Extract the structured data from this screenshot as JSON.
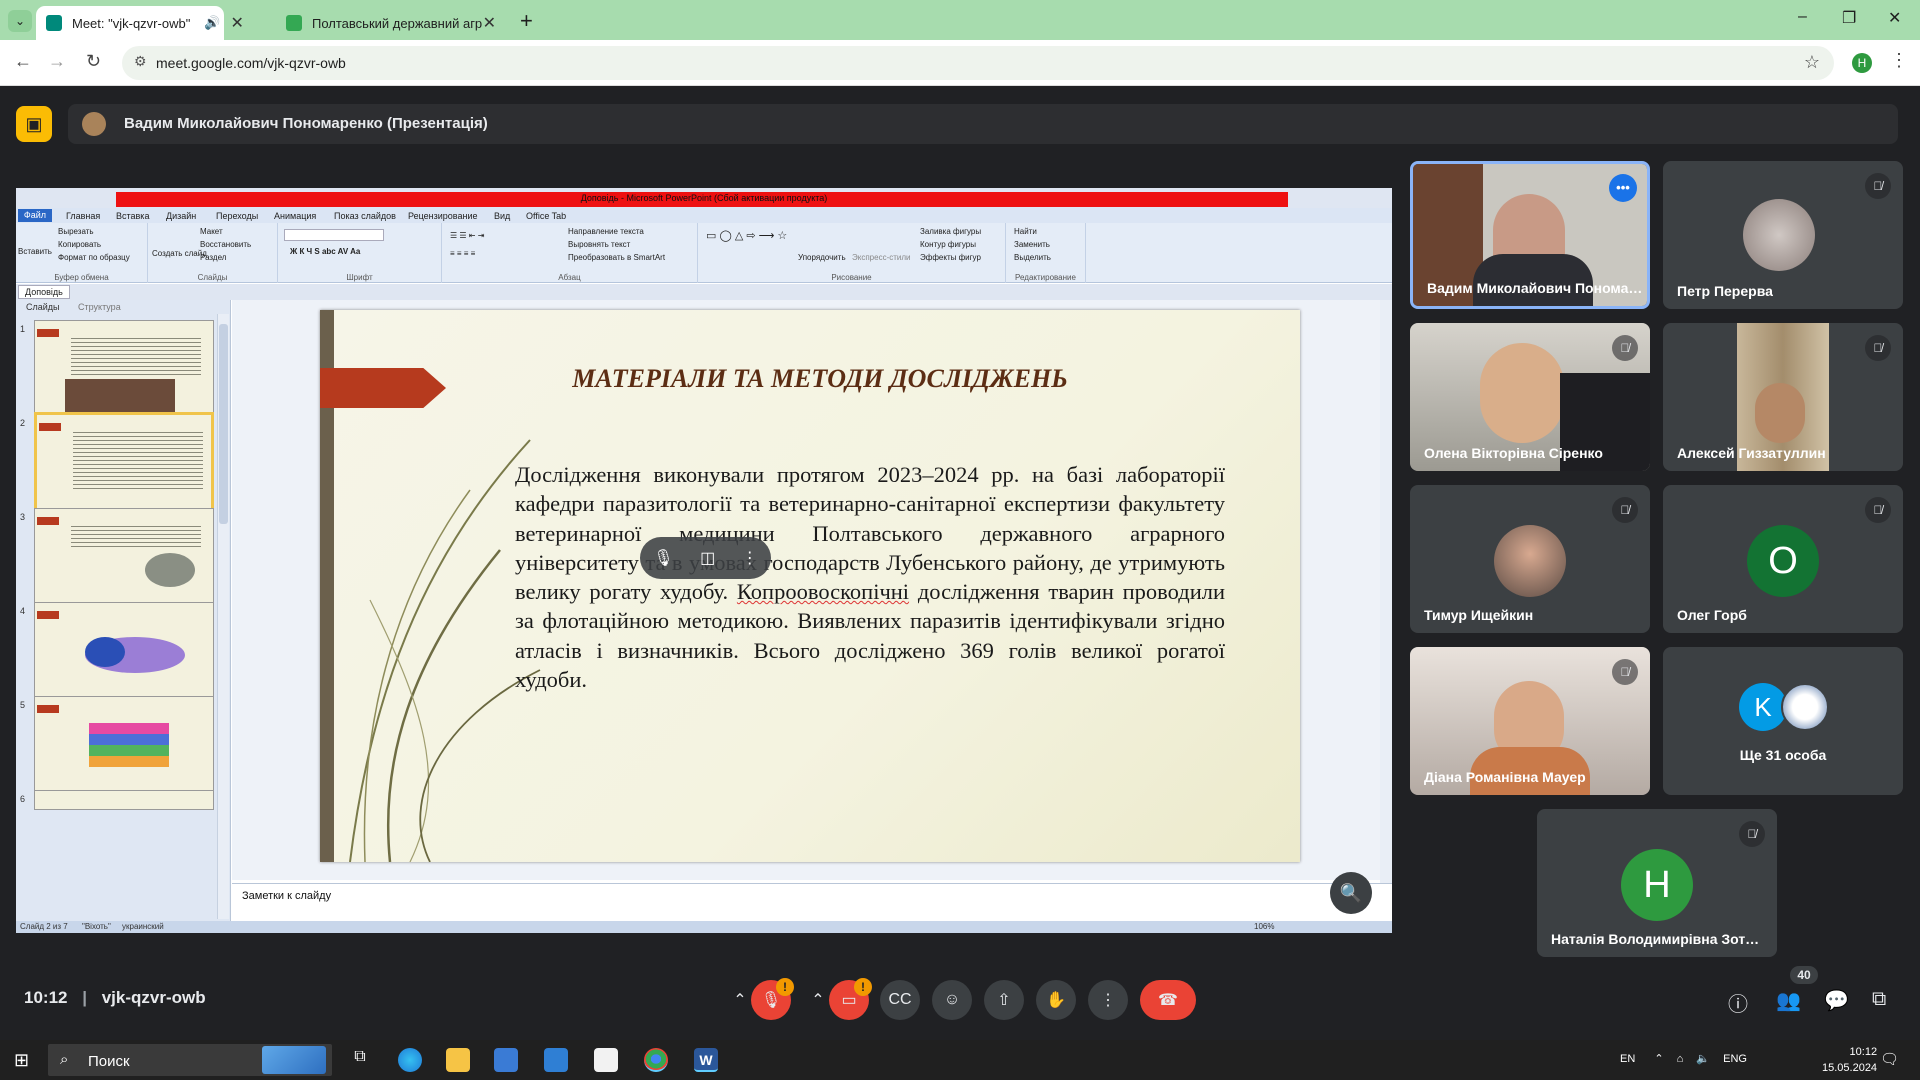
{
  "browser": {
    "tabs": [
      {
        "title": "Meet: \"vjk-qzvr-owb\"",
        "active": true
      },
      {
        "title": "Полтавський державний агра",
        "active": false
      }
    ],
    "tab_search_icon": "chevron-down-icon",
    "new_tab": "+",
    "url": "meet.google.com/vjk-qzvr-owb",
    "profile_initial": "H",
    "window_controls": {
      "minimize": "–",
      "restore": "❐",
      "close": "✕"
    }
  },
  "meet": {
    "presenter_banner": "Вадим Миколайович Пономаренко (Презентація)",
    "meeting_time": "10:12",
    "meeting_code": "vjk-qzvr-owb",
    "participants_count": "40",
    "participants": [
      {
        "name": "Вадим Миколайович Пономаренко",
        "muted": false,
        "active": true,
        "avatar_letter": ""
      },
      {
        "name": "Петр Перерва",
        "muted": true,
        "active": false,
        "avatar_letter": ""
      },
      {
        "name": "Олена Вікторівна Сіренко",
        "muted": true,
        "active": false,
        "avatar_letter": ""
      },
      {
        "name": "Алексей Гиззатуллин",
        "muted": true,
        "active": false,
        "avatar_letter": ""
      },
      {
        "name": "Тимур Ищейкин",
        "muted": true,
        "active": false,
        "avatar_letter": ""
      },
      {
        "name": "Олег Горб",
        "muted": true,
        "active": false,
        "avatar_letter": "О"
      },
      {
        "name": "Діана Романівна Мауер",
        "muted": true,
        "active": false,
        "avatar_letter": ""
      },
      {
        "name": "Ще 31 особа",
        "muted": false,
        "active": false,
        "avatar_letter": "K"
      },
      {
        "name": "Наталія Володимирівна Зотова",
        "muted": true,
        "active": false,
        "avatar_letter": "Н"
      }
    ],
    "badge_alert": "!",
    "colors": {
      "end_call": "#ea4335",
      "active_border": "#8ab4f8",
      "oleg_avatar": "#137333",
      "natalia_avatar": "#2e9a3f",
      "more_avatar": "#039be5"
    }
  },
  "powerpoint": {
    "window_title": "Доповідь - Microsoft PowerPoint (Сбой активации продукта)",
    "file_tab": "Файл",
    "ribbon_tabs": [
      "Главная",
      "Вставка",
      "Дизайн",
      "Переходы",
      "Анимация",
      "Показ слайдов",
      "Рецензирование",
      "Вид",
      "Office Tab"
    ],
    "ribbon_groups": [
      {
        "label": "Буфер обмена",
        "buttons": [
          "Вставить",
          "Вырезать",
          "Копировать",
          "Формат по образцу"
        ]
      },
      {
        "label": "Слайды",
        "buttons": [
          "Создать слайд",
          "Макет",
          "Восстановить",
          "Раздел"
        ]
      },
      {
        "label": "Шрифт",
        "buttons": []
      },
      {
        "label": "Абзац",
        "buttons": [
          "Направление текста",
          "Выровнять текст",
          "Преобразовать в SmartArt"
        ]
      },
      {
        "label": "Рисование",
        "buttons": [
          "Упорядочить",
          "Экспресс-стили",
          "Заливка фигуры",
          "Контур фигуры",
          "Эффекты фигур"
        ]
      },
      {
        "label": "Редактирование",
        "buttons": [
          "Найти",
          "Заменить",
          "Выделить"
        ]
      }
    ],
    "doc_tab": "Доповідь",
    "pane_tabs": [
      "Слайды",
      "Структура"
    ],
    "thumbnail_numbers": [
      "1",
      "2",
      "3",
      "4",
      "5",
      "6"
    ],
    "slide": {
      "title": "МАТЕРІАЛИ ТА МЕТОДИ ДОСЛІДЖЕНЬ",
      "body_part1": "Дослідження виконували протягом 2023–2024 рр. на базі лабораторії кафедри паразитології та ветеринарно-санітарної експертизи факультету ветеринарної медицини Полтавського державного аграрного університету та в умовах господарств Лубенського району, де утримують велику рогату худобу. ",
      "body_underlined": "Копроовоскопічні",
      "body_part2": " дослідження тварин проводили за флотаційною методикою. Виявлених паразитів ідентифікували згідно атласів і визначників. Всього досліджено 369 голів великої рогатої худоби."
    },
    "notes_placeholder": "Заметки к слайду",
    "status": {
      "slide_info": "Слайд 2 из 7",
      "theme": "\"Віхоть\"",
      "language": "украинский",
      "zoom": "106%"
    }
  },
  "taskbar": {
    "search_placeholder": "Поиск",
    "tray_lang": "ENG",
    "tray_input": "EN",
    "time": "10:12",
    "date": "15.05.2024",
    "notification_count": "2"
  }
}
